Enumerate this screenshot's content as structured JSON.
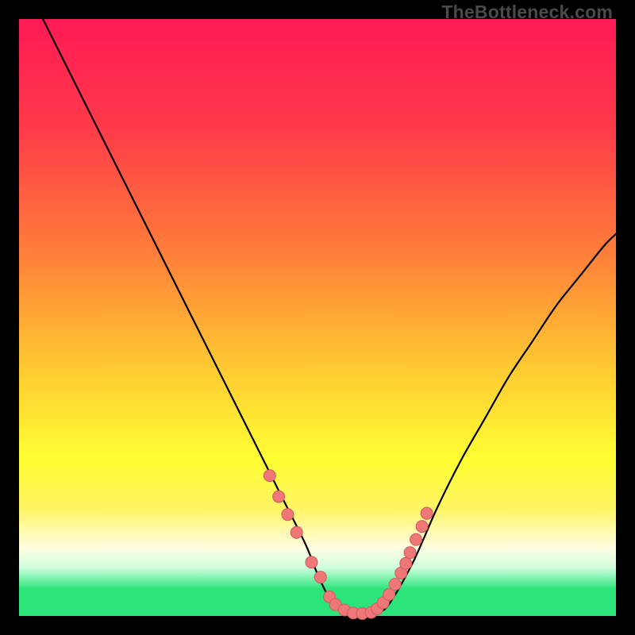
{
  "watermark": "TheBottleneck.com",
  "colors": {
    "background": "#000000",
    "curve": "#000000",
    "dot_fill": "#ef7777",
    "dot_stroke": "#cf5a5a",
    "green_band": "#2be57b",
    "gradient_stops": [
      {
        "offset": 0.0,
        "color": "#ff1a55"
      },
      {
        "offset": 0.18,
        "color": "#ff3a4a"
      },
      {
        "offset": 0.38,
        "color": "#ff7a3a"
      },
      {
        "offset": 0.58,
        "color": "#ffc832"
      },
      {
        "offset": 0.74,
        "color": "#ffff33"
      },
      {
        "offset": 0.82,
        "color": "#fff565"
      },
      {
        "offset": 0.885,
        "color": "#fffde0"
      },
      {
        "offset": 0.918,
        "color": "#d4ffe0"
      },
      {
        "offset": 0.955,
        "color": "#2be57b"
      },
      {
        "offset": 1.0,
        "color": "#2be57b"
      }
    ]
  },
  "chart_data": {
    "type": "line",
    "title": "",
    "xlabel": "",
    "ylabel": "",
    "xlim": [
      0,
      100
    ],
    "ylim": [
      0,
      100
    ],
    "series": [
      {
        "name": "bottleneck-curve",
        "x": [
          4,
          8,
          12,
          16,
          20,
          24,
          28,
          32,
          36,
          40,
          44,
          48,
          50,
          52,
          54,
          56,
          58,
          60,
          62,
          66,
          70,
          74,
          78,
          82,
          86,
          90,
          94,
          98,
          100
        ],
        "y": [
          100,
          92,
          84,
          76,
          68,
          60,
          52,
          44,
          36,
          28,
          20,
          12,
          7,
          3,
          1.2,
          0.6,
          0.4,
          0.6,
          2,
          9,
          18,
          26,
          33,
          40,
          46,
          52,
          57,
          62,
          64
        ]
      }
    ],
    "highlight_points": {
      "name": "near-optimal-dots",
      "x": [
        42.0,
        43.5,
        45.0,
        46.5,
        49.0,
        50.5,
        52.0,
        53.0,
        54.5,
        56.0,
        57.5,
        59.0,
        60.0,
        61.0,
        62.0,
        63.0,
        64.0,
        64.8,
        65.5,
        66.5,
        67.5,
        68.3
      ],
      "y": [
        23.5,
        20.0,
        17.0,
        14.0,
        9.0,
        6.5,
        3.2,
        1.9,
        1.0,
        0.5,
        0.4,
        0.6,
        1.2,
        2.2,
        3.6,
        5.3,
        7.2,
        8.8,
        10.6,
        12.8,
        15.0,
        17.2
      ]
    }
  }
}
